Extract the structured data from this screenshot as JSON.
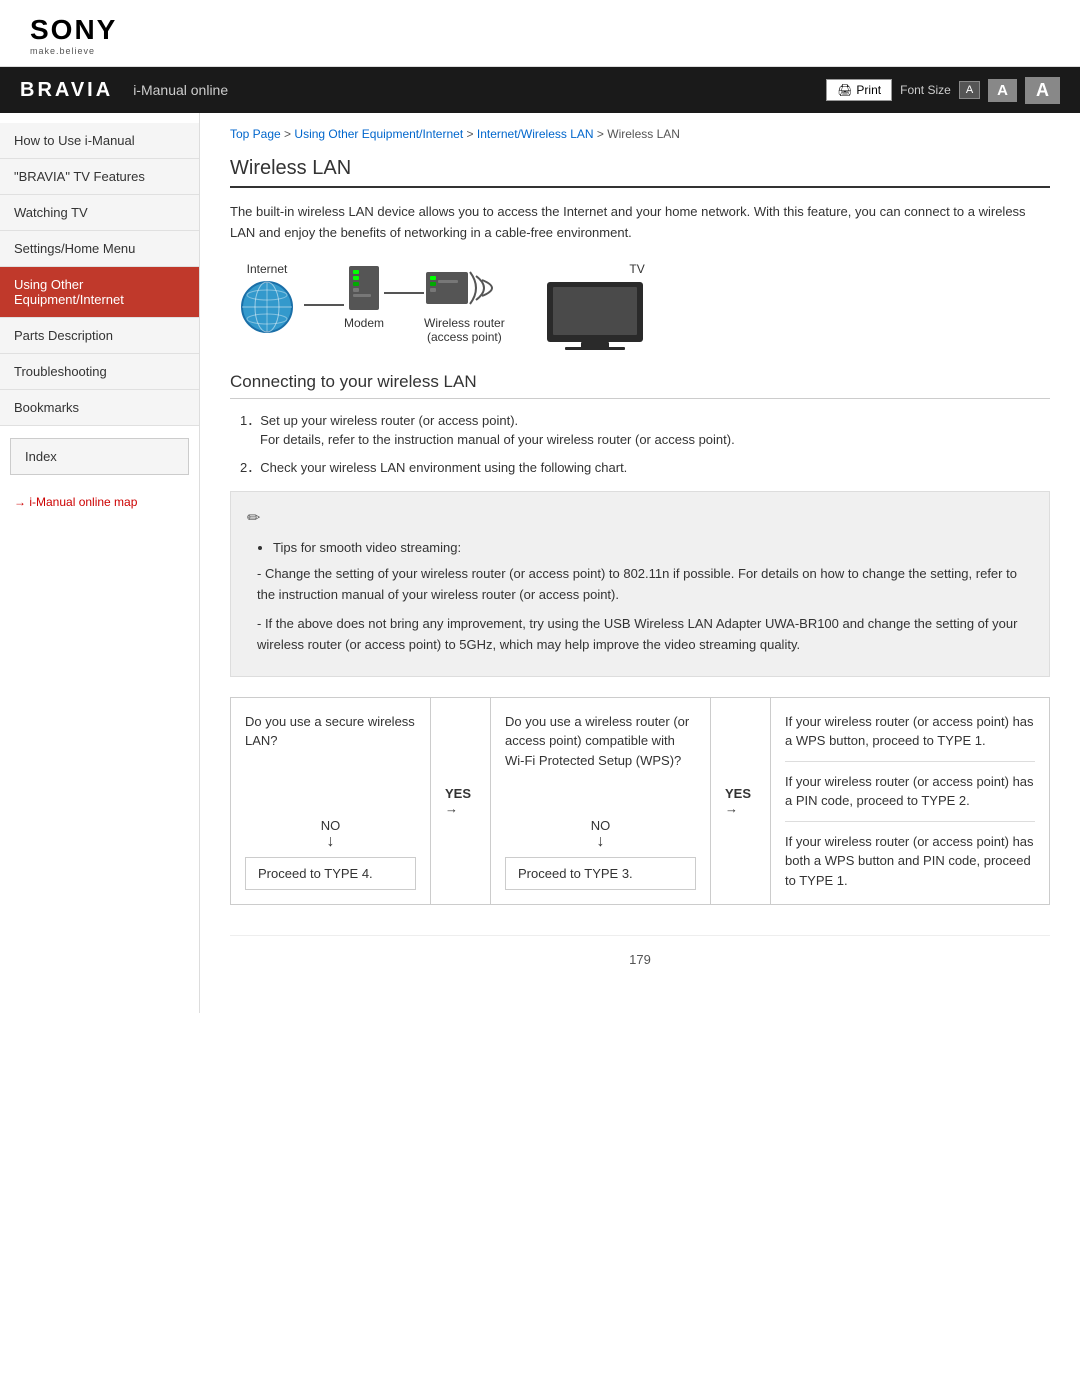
{
  "header": {
    "sony_text": "SONY",
    "sony_tagline": "make.believe"
  },
  "navbar": {
    "bravia": "BRAVIA",
    "title": "i-Manual online",
    "print_label": "Print",
    "font_size_label": "Font Size",
    "font_a_small": "A",
    "font_a_medium": "A",
    "font_a_large": "A"
  },
  "breadcrumb": {
    "top": "Top Page",
    "sep1": " > ",
    "crumb2": "Using Other Equipment/Internet",
    "sep2": " > ",
    "crumb3": "Internet/Wireless LAN",
    "sep3": " > ",
    "crumb4": "Wireless LAN"
  },
  "sidebar": {
    "items": [
      {
        "label": "How to Use i-Manual",
        "active": false
      },
      {
        "label": "\"BRAVIA\" TV Features",
        "active": false
      },
      {
        "label": "Watching TV",
        "active": false
      },
      {
        "label": "Settings/Home Menu",
        "active": false
      },
      {
        "label": "Using Other Equipment/Internet",
        "active": true
      },
      {
        "label": "Parts Description",
        "active": false
      },
      {
        "label": "Troubleshooting",
        "active": false
      },
      {
        "label": "Bookmarks",
        "active": false
      }
    ],
    "index_label": "Index",
    "map_link": "→ i-Manual online map"
  },
  "page": {
    "title": "Wireless LAN",
    "intro": "The built-in wireless LAN device allows you to access the Internet and your home network. With this feature, you can connect to a wireless LAN and enjoy the benefits of networking in a cable-free environment.",
    "diagram": {
      "internet_label": "Internet",
      "modem_label": "Modem",
      "router_label": "Wireless router\n(access point)",
      "tv_label": "TV"
    },
    "section2_title": "Connecting to your wireless LAN",
    "steps": [
      {
        "number": "1",
        "text": "Set up your wireless router (or access point).",
        "sub": "For details, refer to the instruction manual of your wireless router (or access point)."
      },
      {
        "number": "2",
        "text": "Check your wireless LAN environment using the following chart."
      }
    ],
    "note": {
      "bullets": [
        "Tips for smooth video streaming:",
        "- Change the setting of your wireless router (or access point) to 802.11n if possible. For details on how to change the setting, refer to the instruction manual of your wireless router (or access point).",
        "- If the above does not bring any improvement, try using the USB Wireless LAN Adapter UWA-BR100 and change the setting of your wireless router (or access point) to 5GHz, which may help improve the video streaming quality."
      ]
    },
    "flowchart": {
      "q1": "Do you use a secure wireless LAN?",
      "yes_label": "YES →",
      "q2": "Do you use a wireless router (or access point) compatible with Wi-Fi Protected Setup (WPS)?",
      "yes_label2": "YES →",
      "no_label": "NO",
      "no_arrow": "↓",
      "proceed4": "Proceed to TYPE 4.",
      "proceed3": "Proceed to TYPE 3.",
      "result_items": [
        "If your wireless router (or access point) has a WPS button, proceed to TYPE 1.",
        "If your wireless router (or access point) has a PIN code, proceed to TYPE 2.",
        "If your wireless router (or access point) has both a WPS button and PIN code, proceed to TYPE 1."
      ]
    },
    "footer_page": "179"
  }
}
